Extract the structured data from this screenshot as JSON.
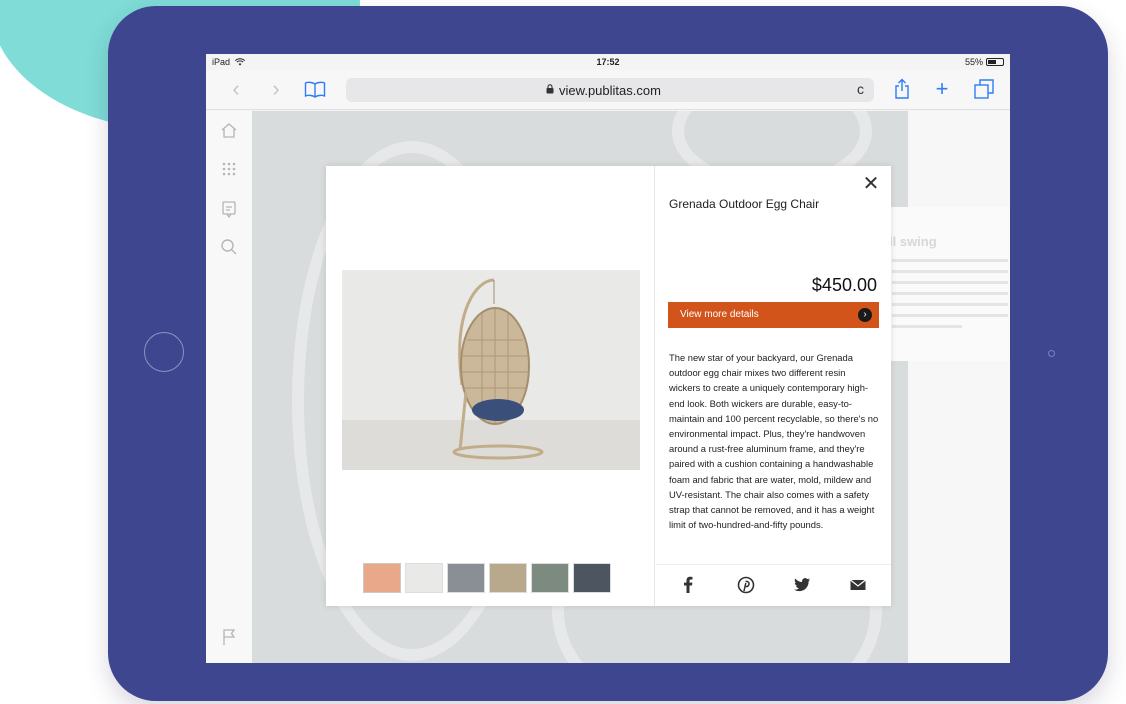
{
  "status_bar": {
    "device": "iPad",
    "time": "17:52",
    "battery": "55%",
    "battery_level": 0.55
  },
  "browser": {
    "url": "view.publitas.com",
    "back_glyph": "‹",
    "forward_glyph": "›",
    "reload_glyph": "c",
    "add_tab_glyph": "+"
  },
  "background_page": {
    "heading": "ll swing"
  },
  "product": {
    "title": "Grenada Outdoor Egg Chair",
    "price": "$450.00",
    "details_button": "View more details",
    "description": "The new star of your backyard, our Grenada outdoor egg chair mixes two different resin wickers to create a uniquely contemporary high-end look. Both wickers are durable, easy-to-maintain and 100 percent recyclable, so there's no environmental impact. Plus, they're handwoven around a rust-free aluminum frame, and they're paired with a cushion containing a handwashable foam and fabric that are water, mold, mildew and UV-resistant. The chair also comes with a safety strap that cannot be removed, and it has a weight limit of two-hundred-and-fifty pounds.",
    "close_glyph": "✕",
    "thumbnails": [
      {
        "color": "#e9a88a"
      },
      {
        "color": "#e9e9e7"
      },
      {
        "color": "#8a8f96"
      },
      {
        "color": "#b8a98c"
      },
      {
        "color": "#7d8a80"
      },
      {
        "color": "#4d5560"
      }
    ]
  },
  "colors": {
    "ipad_frame": "#3f4690",
    "accent_teal": "#7fdcd6",
    "safari_blue": "#2f7df6",
    "cta_orange": "#d2541b"
  },
  "icons": {
    "sidebar": [
      "home-icon",
      "grid-icon",
      "catalog-icon",
      "search-icon",
      "flag-icon"
    ],
    "share": [
      "facebook-icon",
      "pinterest-icon",
      "twitter-icon",
      "mail-icon"
    ]
  }
}
